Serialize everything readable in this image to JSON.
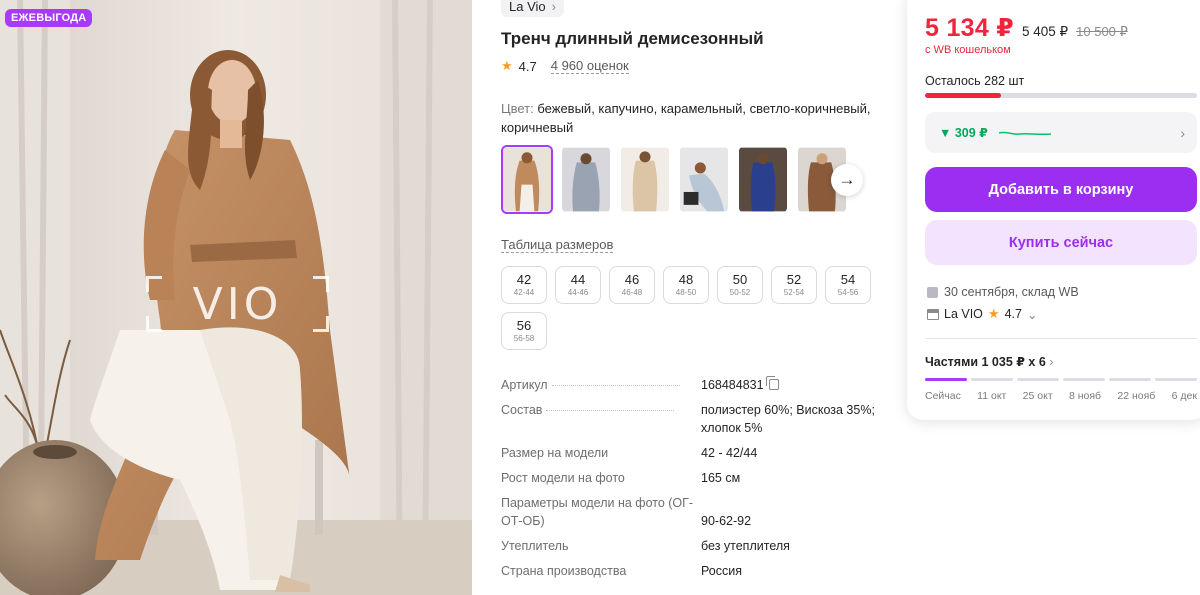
{
  "photo": {
    "promo_badge": "ЕЖЕВЫГОДА",
    "watermark_text": "VIO"
  },
  "product": {
    "brand": "La Vio",
    "title": "Тренч длинный демисезонный",
    "rating": "4.7",
    "reviews": "4 960 оценок",
    "color_label": "Цвет:",
    "color_value": "бежевый, капучино, карамельный, светло-коричневый, коричневый",
    "size_table_label": "Таблица размеров",
    "sizes": [
      {
        "size": "42",
        "range": "42-44"
      },
      {
        "size": "44",
        "range": "44-46"
      },
      {
        "size": "46",
        "range": "46-48"
      },
      {
        "size": "48",
        "range": "48-50"
      },
      {
        "size": "50",
        "range": "50-52"
      },
      {
        "size": "52",
        "range": "52-54"
      },
      {
        "size": "54",
        "range": "54-56"
      },
      {
        "size": "56",
        "range": "56-58"
      }
    ],
    "specs": [
      {
        "name": "Артикул",
        "value": "168484831"
      },
      {
        "name": "Состав",
        "value": "полиэстер 60%; Вискоза 35%; хлопок 5%"
      },
      {
        "name": "Размер на модели",
        "value": "42 - 42/44"
      },
      {
        "name": "Рост модели на фото",
        "value": "165 см"
      },
      {
        "name": "Параметры модели на фото (ОГ-ОТ-ОБ)",
        "value": "90-62-92"
      },
      {
        "name": "Утеплитель",
        "value": "без утеплителя"
      },
      {
        "name": "Страна производства",
        "value": "Россия"
      }
    ]
  },
  "price_card": {
    "price_wallet": "5 134 ₽",
    "price": "5 405 ₽",
    "price_old": "10 500 ₽",
    "wallet_note": "с WB кошельком",
    "stock_text": "Осталось 282 шт",
    "stock_fill_fraction": 0.28,
    "bonus": "▼ 309 ₽",
    "add_to_cart": "Добавить в корзину",
    "buy_now": "Купить сейчас",
    "delivery": "30 сентября, склад WB",
    "seller_name": "La VIO",
    "seller_rating": "4.7",
    "installments": "Частями 1 035 ₽ x 6",
    "installment_dates": [
      "Сейчас",
      "11 окт",
      "25 окт",
      "8 нояб",
      "22 нояб",
      "6 дек"
    ]
  },
  "colors": {
    "accent": "#a73afd",
    "price_red": "#f0243d",
    "bonus_green": "#00a859"
  }
}
